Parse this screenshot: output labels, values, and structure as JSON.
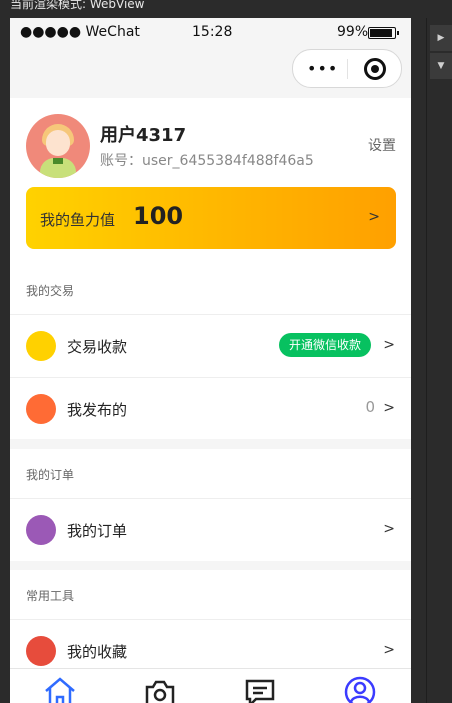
{
  "devtools": {
    "render_mode": "当前渲染模式: WebView"
  },
  "status_bar": {
    "carrier": "●●●●● WeChat",
    "time": "15:28",
    "battery": "99%"
  },
  "nav_capsule": {
    "more": "•••"
  },
  "profile": {
    "username": "用户4317",
    "account": "账号：user_6455384f488f46a5",
    "settings_label": "设置",
    "power_label": "我的鱼力值",
    "power_value": "100",
    "arrow": ">"
  },
  "sections": {
    "trade": {
      "title": "我的交易",
      "items": [
        {
          "label": "交易收款",
          "badge": "开通微信收款",
          "arrow": ">",
          "color": "#ffd100"
        },
        {
          "label": "我发布的",
          "count": "0",
          "arrow": ">",
          "color": "#ff6b35"
        }
      ]
    },
    "orders": {
      "title": "我的订单",
      "items": [
        {
          "label": "我的订单",
          "arrow": ">",
          "color": "#9b59b6"
        }
      ]
    },
    "tools": {
      "title": "常用工具",
      "items": [
        {
          "label": "我的收藏",
          "arrow": ">",
          "color": "#e74c3c"
        }
      ]
    }
  },
  "tabbar": {
    "items": [
      {
        "icon": "home-icon",
        "color": "#2f6bff"
      },
      {
        "icon": "camera-icon",
        "color": "#222222"
      },
      {
        "icon": "message-icon",
        "color": "#222222"
      },
      {
        "icon": "user-icon",
        "color": "#3b3bff"
      }
    ]
  }
}
